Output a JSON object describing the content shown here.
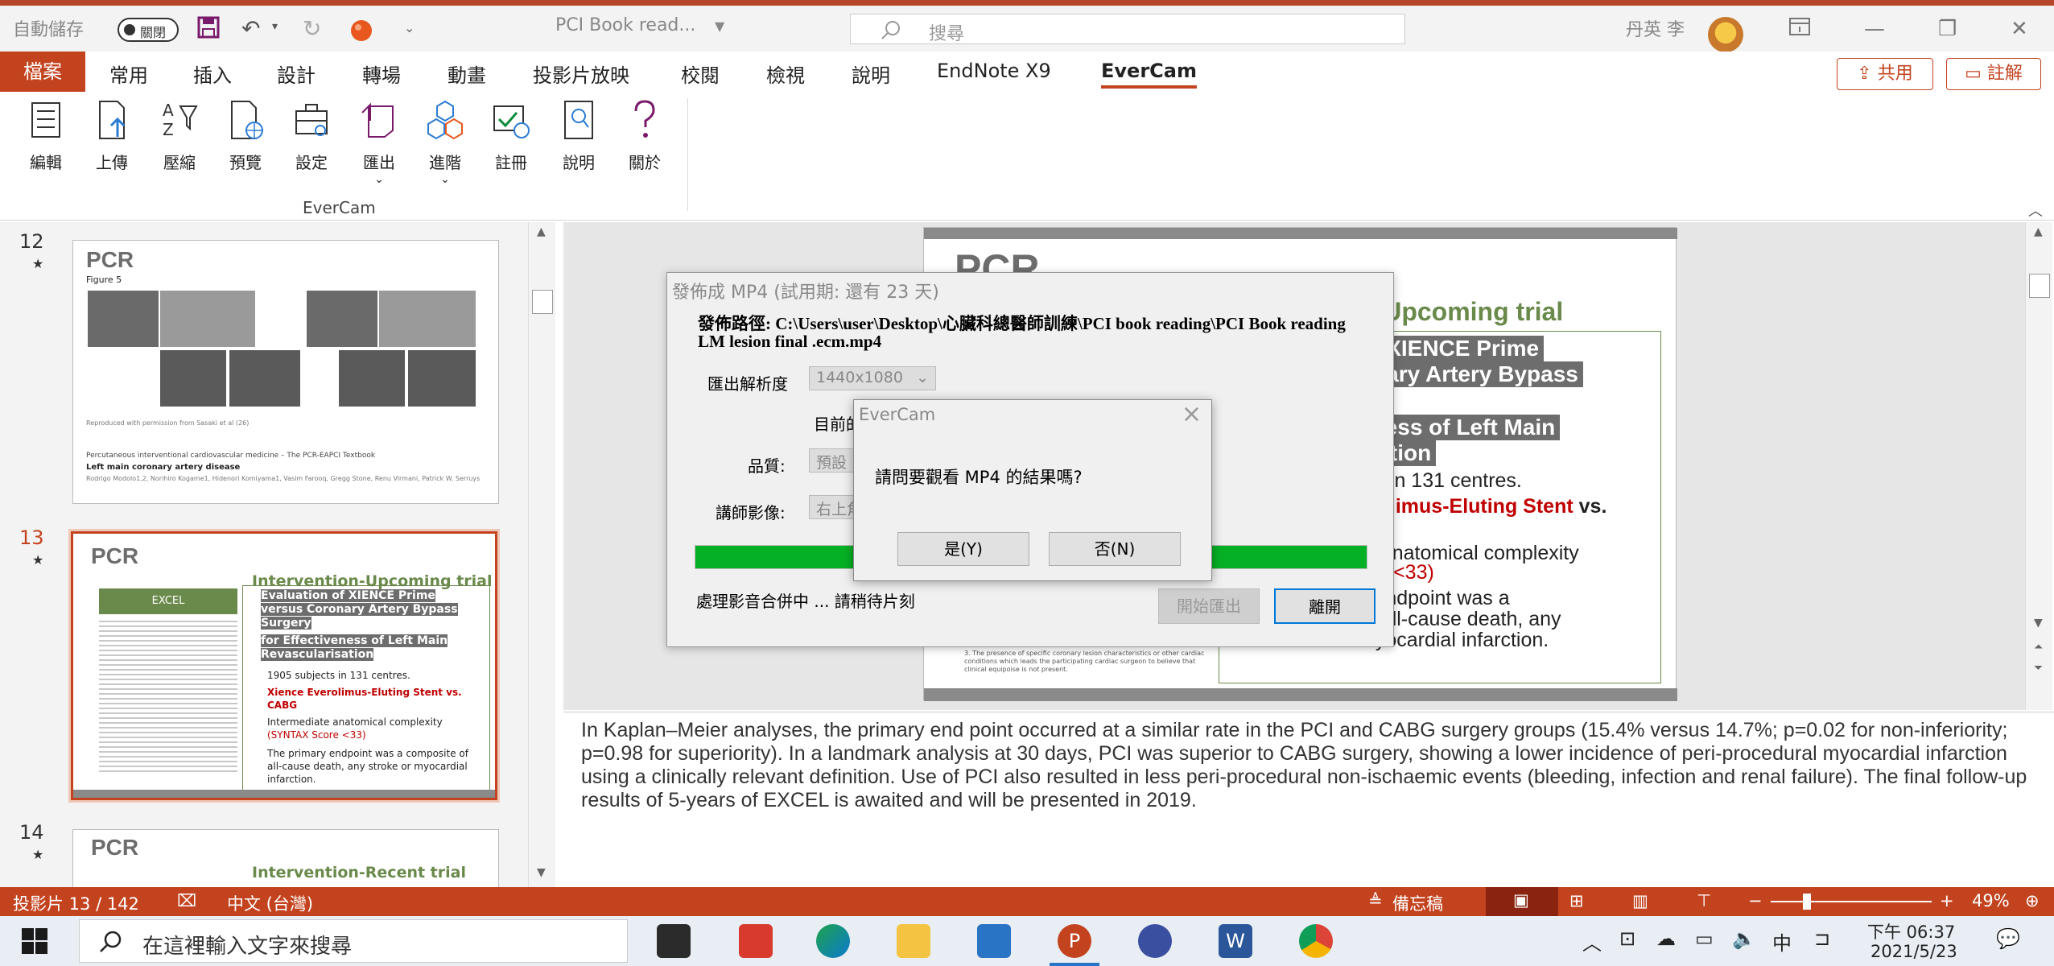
{
  "titlebar": {
    "autosave_label": "自動儲存",
    "autosave_state": "關閉",
    "doc_title": "PCI Book read...",
    "search_placeholder": "搜尋",
    "user_name": "丹英 李"
  },
  "tabs": [
    "檔案",
    "常用",
    "插入",
    "設計",
    "轉場",
    "動畫",
    "投影片放映",
    "校閱",
    "檢視",
    "說明",
    "EndNote X9",
    "EverCam"
  ],
  "active_tab": "EverCam",
  "share_label": "共用",
  "comment_label": "註解",
  "ribbon": {
    "buttons": [
      "編輯",
      "上傳",
      "壓縮",
      "預覽",
      "設定",
      "匯出",
      "進階",
      "註冊",
      "說明",
      "關於"
    ],
    "group_label": "EverCam"
  },
  "thumbnails": {
    "slide12": {
      "number": "12",
      "logo": "PCR",
      "figure_label": "Figure 5",
      "repro": "Reproduced with permission from Sasaki et al (26)",
      "caption1": "Percutaneous interventional cardiovascular medicine – The PCR-EAPCI Textbook",
      "caption2": "Left main coronary artery disease",
      "caption3": "Rodrigo Modolo1,2, Norihiro Kogame1, Hidenori Komiyama1, Vasim Farooq, Gregg Stone, Renu Virmani, Patrick W. Serruys"
    },
    "slide13": {
      "number": "13",
      "logo": "PCR",
      "title": "Intervention-Upcoming trial",
      "excel_label": "EXCEL",
      "hl1": "Evaluation of XIENCE Prime versus Coronary Artery Bypass Surgery",
      "hl2": "for Effectiveness of Left Main Revascularisation",
      "b1": "1905 subjects in 131 centres.",
      "b2": "Xience Everolimus-Eluting Stent vs. CABG",
      "b3a": "Intermediate anatomical complexity",
      "b3b": "(SYNTAX Score <33)",
      "b4": "The primary endpoint was a composite of all-cause death, any stroke or myocardial infarction."
    },
    "slide14": {
      "number": "14",
      "logo": "PCR",
      "title": "Intervention-Recent trial"
    }
  },
  "main_slide": {
    "logo": "PCR",
    "title": "n-Upcoming trial",
    "l1": "of XIENCE Prime",
    "l2": "onary Artery Bypass",
    "l3": "eness of Left Main",
    "l4": "isation",
    "l5": "cts in 131 centres.",
    "l6a": "erolimus-Eluting Stent",
    "l6b": " vs.",
    "l7": "te anatomical complexity",
    "l8": "ore <33)",
    "l9": "y endpoint was a",
    "l10": "of all-cause death, any",
    "l11": "myocardial infarction.",
    "footnote": "3. The presence of specific coronary lesion characteristics or other cardiac conditions which leads the participating cardiac surgeon to believe that clinical equipoise is not present."
  },
  "notes": "In Kaplan–Meier analyses, the primary end point occurred at a similar rate in the PCI and CABG surgery groups (15.4% versus 14.7%; p=0.02 for non-inferiority; p=0.98 for superiority). In a landmark analysis at 30 days, PCI was superior to CABG surgery, showing a lower incidence of peri-procedural myocardial infarction using a clinically relevant definition. Use of PCI also resulted in less peri-procedural non-ischaemic events (bleeding, infection and renal failure). The final follow-up results of 5-years of EXCEL is awaited and will be presented in 2019.",
  "statusbar": {
    "slide_info": "投影片 13 / 142",
    "language": "中文 (台灣)",
    "notes_label": "備忘稿",
    "zoom_minus": "−",
    "zoom_plus": "+",
    "zoom": "49%"
  },
  "taskbar": {
    "search_placeholder": "在這裡輸入文字來搜尋",
    "ime": "中",
    "time": "下午 06:37",
    "date": "2021/5/23"
  },
  "dialog_publish": {
    "title": "發佈成 MP4 (試用期: 還有 23 天)",
    "path_text": "發佈路徑: C:\\Users\\user\\Desktop\\心臟科總醫師訓練\\PCI book reading\\PCI Book reading LM lesion final .ecm.mp4",
    "resolution_label": "匯出解析度",
    "resolution_value": "1440x1080",
    "current_label": "目前的",
    "quality_label": "品質:",
    "quality_value": "預設",
    "instructor_label": "講師影像:",
    "instructor_value": "右上角",
    "progress": 1.0,
    "status_text": "處理影音合併中 ... 請稍待片刻",
    "start_export": "開始匯出",
    "leave": "離開"
  },
  "dialog_confirm": {
    "title": "EverCam",
    "message": "請問要觀看 MP4 的結果嗎?",
    "yes": "是(Y)",
    "no": "否(N)"
  },
  "colors": {
    "accent": "#c4431f",
    "pcr_green": "#6a8a4b",
    "progress_green": "#06b025"
  }
}
